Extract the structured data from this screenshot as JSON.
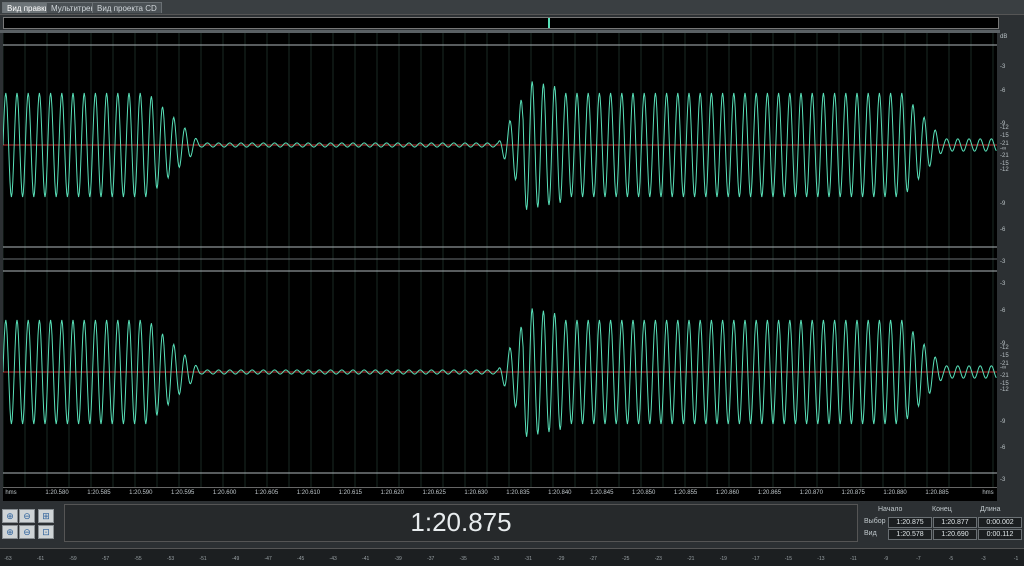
{
  "tabs": [
    {
      "label": "Вид правки",
      "active": true
    },
    {
      "label": "Мультитрек",
      "active": false
    },
    {
      "label": "Вид проекта CD",
      "active": false
    }
  ],
  "wave_color": "#58e0b8",
  "centerline_color": "#c03030",
  "db_scale": {
    "unit": "dB",
    "upper_labels": [
      "-3",
      "-6",
      "-9",
      "-12",
      "-15",
      "-21",
      "-∞",
      "-21",
      "-15",
      "-12",
      "-9",
      "-6",
      "-3"
    ],
    "lower_labels": [
      "-3",
      "-6",
      "-9",
      "-12",
      "-15",
      "-21",
      "-∞",
      "-21",
      "-15",
      "-12",
      "-9",
      "-6",
      "-3"
    ]
  },
  "ruler": {
    "left_unit": "hms",
    "right_unit": "hms",
    "ticks": [
      "1:20.580",
      "1:20.585",
      "1:20.590",
      "1:20.595",
      "1:20.600",
      "1:20.605",
      "1:20.610",
      "1:20.615",
      "1:20.620",
      "1:20.625",
      "1:20.630",
      "1:20.835",
      "1:20.840",
      "1:20.845",
      "1:20.850",
      "1:20.855",
      "1:20.860",
      "1:20.865",
      "1:20.870",
      "1:20.875",
      "1:20.880",
      "1:20.885"
    ]
  },
  "zoom_buttons": [
    {
      "icon": "zoom-in-horizontal-icon",
      "glyph": "⊕"
    },
    {
      "icon": "zoom-out-horizontal-icon",
      "glyph": "⊖"
    },
    {
      "icon": "zoom-full-icon",
      "glyph": "⊞"
    },
    {
      "icon": "zoom-in-vertical-icon",
      "glyph": "⊕"
    },
    {
      "icon": "zoom-out-vertical-icon",
      "glyph": "⊖"
    },
    {
      "icon": "zoom-selection-icon",
      "glyph": "⊡"
    }
  ],
  "time_display": "1:20.875",
  "selection": {
    "headers": {
      "start": "Начало",
      "end": "Конец",
      "length": "Длина"
    },
    "rows": [
      {
        "label": "Выбор",
        "start": "1:20.875",
        "end": "1:20.877",
        "length": "0:00.002"
      },
      {
        "label": "Вид",
        "start": "1:20.578",
        "end": "1:20.690",
        "length": "0:00.112"
      }
    ]
  },
  "level_meter": {
    "labels": [
      "-63",
      "-61",
      "-59",
      "-57",
      "-55",
      "-53",
      "-51",
      "-49",
      "-47",
      "-45",
      "-43",
      "-41",
      "-39",
      "-37",
      "-35",
      "-33",
      "-31",
      "-29",
      "-27",
      "-25",
      "-23",
      "-21",
      "-19",
      "-17",
      "-15",
      "-13",
      "-11",
      "-9",
      "-7",
      "-5",
      "-3",
      "-1"
    ]
  }
}
